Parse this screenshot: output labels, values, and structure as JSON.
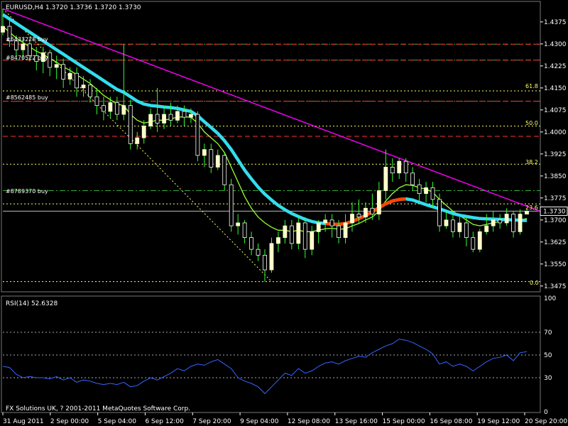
{
  "header": {
    "symbol_info": "EURUSD,H4  1.3720 1.3736 1.3720 1.3730",
    "rsi_label": "RSI(14) 52.6328",
    "copyright": "FX Solutions UK, ? 2001-2011 MetaQuotes Software Corp."
  },
  "order_labels": [
    "#6433228 buy",
    "#8470522 buy",
    "#8562485 buy",
    "#8789370 buy"
  ],
  "order_levels": [
    1.4299,
    1.4245,
    1.4105,
    1.38
  ],
  "fib_labels": [
    "61.8",
    "50.0",
    "38.2",
    "23.6",
    "0.0"
  ],
  "fib_levels": [
    1.414,
    1.402,
    1.389,
    1.3755,
    1.349
  ],
  "red_lines": [
    1.4299,
    1.4245,
    1.4105,
    1.3985
  ],
  "current_price_label": "1.3730",
  "current_price": 1.373,
  "colors": {
    "bull_candle": "#ffffcc",
    "wick": "#33ff33",
    "fast_ma": "#99ff33",
    "slow_ma": "#33ddee",
    "slow_ma_down": "#ff4400",
    "trendline": "#ee00ee",
    "rsi": "#3366ff",
    "fib": "#ffff66",
    "order_line": "#33aa33",
    "red_line": "#ff3333"
  },
  "chart_data": [
    {
      "type": "line",
      "title": "EURUSD,H4",
      "y_ticks": [
        "1.4375",
        "1.4300",
        "1.4225",
        "1.4150",
        "1.4075",
        "1.4000",
        "1.3925",
        "1.3850",
        "1.3775",
        "1.3700",
        "1.3625",
        "1.3550",
        "1.3475"
      ],
      "ylim": [
        1.346,
        1.444
      ],
      "x_ticks": [
        "31 Aug 2011",
        "2 Sep 00:00",
        "5 Sep 04:00",
        "6 Sep 12:00",
        "7 Sep 20:00",
        "9 Sep 04:00",
        "12 Sep 08:00",
        "13 Sep 16:00",
        "15 Sep 00:00",
        "16 Sep 08:00",
        "19 Sep 12:00",
        "20 Sep 20:00"
      ],
      "candles": [
        [
          1.434,
          1.436,
          1.442,
          1.433
        ],
        [
          1.436,
          1.431,
          1.438,
          1.429
        ],
        [
          1.431,
          1.428,
          1.433,
          1.426
        ],
        [
          1.428,
          1.43,
          1.432,
          1.425
        ],
        [
          1.43,
          1.426,
          1.432,
          1.424
        ],
        [
          1.426,
          1.424,
          1.429,
          1.421
        ],
        [
          1.424,
          1.427,
          1.429,
          1.42
        ],
        [
          1.427,
          1.422,
          1.428,
          1.419
        ],
        [
          1.422,
          1.423,
          1.426,
          1.418
        ],
        [
          1.423,
          1.418,
          1.425,
          1.415
        ],
        [
          1.418,
          1.42,
          1.422,
          1.416
        ],
        [
          1.42,
          1.415,
          1.422,
          1.412
        ],
        [
          1.415,
          1.416,
          1.419,
          1.412
        ],
        [
          1.416,
          1.412,
          1.418,
          1.41
        ],
        [
          1.412,
          1.409,
          1.415,
          1.406
        ],
        [
          1.409,
          1.407,
          1.412,
          1.404
        ],
        [
          1.407,
          1.41,
          1.412,
          1.405
        ],
        [
          1.41,
          1.406,
          1.412,
          1.404
        ],
        [
          1.406,
          1.409,
          1.43,
          1.404
        ],
        [
          1.409,
          1.396,
          1.411,
          1.394
        ],
        [
          1.396,
          1.398,
          1.4,
          1.394
        ],
        [
          1.398,
          1.402,
          1.404,
          1.396
        ],
        [
          1.402,
          1.406,
          1.408,
          1.401
        ],
        [
          1.406,
          1.403,
          1.415,
          1.4
        ],
        [
          1.403,
          1.406,
          1.409,
          1.401
        ],
        [
          1.406,
          1.404,
          1.41,
          1.402
        ],
        [
          1.404,
          1.407,
          1.409,
          1.403
        ],
        [
          1.407,
          1.405,
          1.409,
          1.402
        ],
        [
          1.405,
          1.406,
          1.408,
          1.403
        ],
        [
          1.406,
          1.392,
          1.407,
          1.39
        ],
        [
          1.392,
          1.394,
          1.396,
          1.388
        ],
        [
          1.394,
          1.388,
          1.396,
          1.386
        ],
        [
          1.388,
          1.392,
          1.394,
          1.387
        ],
        [
          1.392,
          1.382,
          1.393,
          1.38
        ],
        [
          1.382,
          1.368,
          1.384,
          1.366
        ],
        [
          1.368,
          1.369,
          1.372,
          1.365
        ],
        [
          1.369,
          1.364,
          1.37,
          1.362
        ],
        [
          1.364,
          1.36,
          1.366,
          1.358
        ],
        [
          1.36,
          1.358,
          1.362,
          1.356
        ],
        [
          1.358,
          1.353,
          1.36,
          1.349
        ],
        [
          1.353,
          1.362,
          1.364,
          1.352
        ],
        [
          1.362,
          1.364,
          1.366,
          1.359
        ],
        [
          1.364,
          1.368,
          1.37,
          1.362
        ],
        [
          1.368,
          1.362,
          1.37,
          1.36
        ],
        [
          1.362,
          1.369,
          1.371,
          1.36
        ],
        [
          1.369,
          1.36,
          1.371,
          1.357
        ],
        [
          1.36,
          1.366,
          1.368,
          1.358
        ],
        [
          1.366,
          1.369,
          1.37,
          1.362
        ],
        [
          1.369,
          1.37,
          1.372,
          1.366
        ],
        [
          1.37,
          1.368,
          1.372,
          1.364
        ],
        [
          1.368,
          1.364,
          1.37,
          1.362
        ],
        [
          1.364,
          1.369,
          1.372,
          1.362
        ],
        [
          1.369,
          1.372,
          1.376,
          1.366
        ],
        [
          1.372,
          1.371,
          1.377,
          1.369
        ],
        [
          1.371,
          1.374,
          1.376,
          1.369
        ],
        [
          1.374,
          1.372,
          1.379,
          1.37
        ],
        [
          1.372,
          1.38,
          1.383,
          1.37
        ],
        [
          1.38,
          1.388,
          1.394,
          1.377
        ],
        [
          1.388,
          1.386,
          1.391,
          1.383
        ],
        [
          1.386,
          1.39,
          1.391,
          1.384
        ],
        [
          1.39,
          1.386,
          1.391,
          1.383
        ],
        [
          1.386,
          1.382,
          1.388,
          1.38
        ],
        [
          1.382,
          1.379,
          1.384,
          1.376
        ],
        [
          1.379,
          1.381,
          1.383,
          1.376
        ],
        [
          1.381,
          1.377,
          1.383,
          1.374
        ],
        [
          1.377,
          1.368,
          1.379,
          1.366
        ],
        [
          1.368,
          1.37,
          1.373,
          1.367
        ],
        [
          1.37,
          1.366,
          1.372,
          1.364
        ],
        [
          1.366,
          1.369,
          1.371,
          1.364
        ],
        [
          1.369,
          1.364,
          1.371,
          1.361
        ],
        [
          1.364,
          1.36,
          1.366,
          1.359
        ],
        [
          1.36,
          1.366,
          1.367,
          1.359
        ],
        [
          1.366,
          1.368,
          1.372,
          1.365
        ],
        [
          1.368,
          1.37,
          1.373,
          1.366
        ],
        [
          1.37,
          1.369,
          1.372,
          1.367
        ],
        [
          1.369,
          1.372,
          1.374,
          1.368
        ],
        [
          1.372,
          1.366,
          1.373,
          1.364
        ],
        [
          1.366,
          1.372,
          1.3736,
          1.365
        ],
        [
          1.372,
          1.373,
          1.3736,
          1.372
        ]
      ],
      "fast_ma": [
        1.436,
        1.434,
        1.432,
        1.4305,
        1.429,
        1.4275,
        1.4265,
        1.425,
        1.4238,
        1.4222,
        1.421,
        1.4195,
        1.418,
        1.4165,
        1.4145,
        1.4125,
        1.411,
        1.4095,
        1.409,
        1.406,
        1.404,
        1.403,
        1.4035,
        1.404,
        1.404,
        1.4045,
        1.405,
        1.4052,
        1.405,
        1.403,
        1.4,
        1.398,
        1.396,
        1.393,
        1.388,
        1.383,
        1.378,
        1.374,
        1.371,
        1.369,
        1.3675,
        1.3665,
        1.3665,
        1.366,
        1.3665,
        1.366,
        1.366,
        1.3665,
        1.367,
        1.3672,
        1.3668,
        1.367,
        1.368,
        1.3688,
        1.37,
        1.371,
        1.373,
        1.3765,
        1.379,
        1.381,
        1.382,
        1.3818,
        1.381,
        1.3805,
        1.3795,
        1.377,
        1.375,
        1.373,
        1.3715,
        1.37,
        1.3685,
        1.368,
        1.3685,
        1.369,
        1.3695,
        1.37,
        1.3695,
        1.37,
        1.3705
      ],
      "slow_ma": [
        1.44,
        1.4385,
        1.437,
        1.4355,
        1.434,
        1.4325,
        1.431,
        1.4295,
        1.428,
        1.4265,
        1.425,
        1.4235,
        1.422,
        1.4205,
        1.419,
        1.4175,
        1.416,
        1.4145,
        1.4135,
        1.412,
        1.4105,
        1.4095,
        1.409,
        1.4088,
        1.4085,
        1.4083,
        1.408,
        1.4075,
        1.407,
        1.4055,
        1.4035,
        1.4015,
        1.3995,
        1.397,
        1.394,
        1.3905,
        1.387,
        1.384,
        1.3812,
        1.3788,
        1.3768,
        1.375,
        1.3735,
        1.3722,
        1.3712,
        1.3702,
        1.3695,
        1.369,
        1.3688,
        1.3686,
        1.3685,
        1.3688,
        1.3695,
        1.3705,
        1.3715,
        1.3728,
        1.3742,
        1.3755,
        1.3765,
        1.377,
        1.3772,
        1.3768,
        1.376,
        1.3752,
        1.3745,
        1.3738,
        1.373,
        1.3722,
        1.3716,
        1.3712,
        1.3708,
        1.3705,
        1.3704,
        1.3703,
        1.3702,
        1.3701,
        1.37,
        1.3699,
        1.3698
      ],
      "slow_ma_down_range": [
        48,
        60
      ],
      "trendline": [
        [
          0,
          1.442
        ],
        [
          78,
          1.374
        ]
      ],
      "diagonal": [
        [
          0,
          1.442
        ],
        [
          40,
          1.349
        ]
      ]
    },
    {
      "type": "line",
      "title": "RSI(14) 52.6328",
      "y_ticks": [
        "100",
        "70",
        "50",
        "30",
        "0"
      ],
      "ylim": [
        0,
        100
      ],
      "levels": [
        70,
        50,
        30
      ],
      "values": [
        40,
        39,
        33,
        30,
        31,
        30,
        30,
        29,
        31,
        28,
        30,
        26,
        28,
        27,
        25,
        24,
        25,
        24,
        26,
        22,
        23,
        27,
        30,
        28,
        31,
        34,
        38,
        36,
        40,
        42,
        41,
        44,
        46,
        42,
        38,
        30,
        27,
        25,
        22,
        16,
        22,
        28,
        34,
        32,
        38,
        34,
        36,
        40,
        43,
        44,
        42,
        45,
        47,
        49,
        48,
        52,
        55,
        58,
        60,
        64,
        63,
        61,
        58,
        55,
        51,
        42,
        44,
        40,
        42,
        40,
        36,
        40,
        44,
        47,
        48,
        50,
        45,
        52,
        53
      ]
    }
  ]
}
